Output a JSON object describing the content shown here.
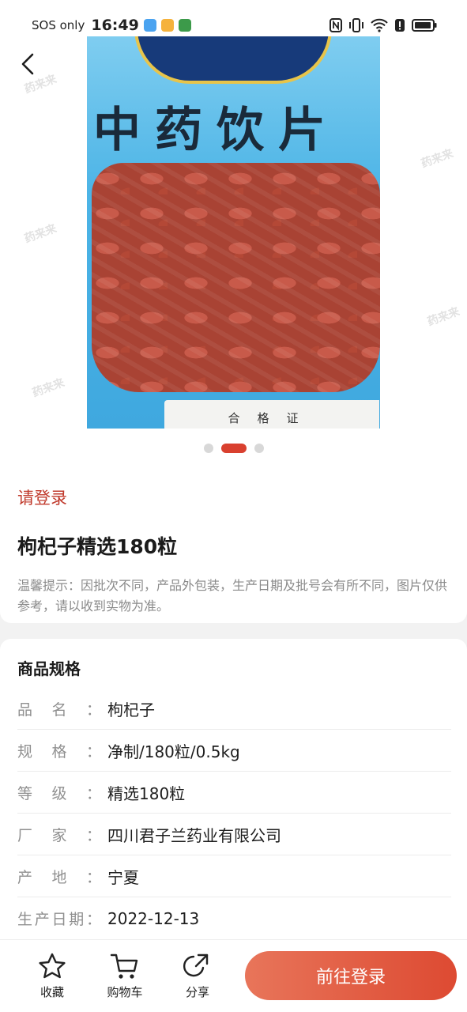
{
  "status_bar": {
    "carrier": "SOS only",
    "time": "16:49"
  },
  "hero": {
    "package_title": "中药饮片",
    "certificate_label": "合格证",
    "watermark": "药来来",
    "carousel_total": 3,
    "carousel_active": 2
  },
  "info": {
    "login_prompt": "请登录",
    "product_title": "枸杞子精选180粒",
    "tip": "温馨提示：因批次不同，产品外包装，生产日期及批号会有所不同，图片仅供参考，请以收到实物为准。"
  },
  "spec": {
    "heading": "商品规格",
    "rows": [
      {
        "label": "品名：",
        "value": "枸杞子"
      },
      {
        "label": "规格：",
        "value": "净制/180粒/0.5kg"
      },
      {
        "label": "等级：",
        "value": "精选180粒"
      },
      {
        "label": "厂家：",
        "value": "四川君子兰药业有限公司"
      },
      {
        "label": "产地：",
        "value": "宁夏"
      },
      {
        "label": "生产日期：",
        "value": "2022-12-13"
      }
    ]
  },
  "bottom_bar": {
    "favorite_label": "收藏",
    "cart_label": "购物车",
    "share_label": "分享",
    "login_button": "前往登录"
  },
  "colors": {
    "accent": "#d9402f",
    "button_gradient_start": "#e8755a",
    "button_gradient_end": "#dd4a32"
  },
  "icons": {
    "back": "chevron-left-icon",
    "favorite": "star-icon",
    "cart": "cart-icon",
    "share": "share-icon"
  }
}
